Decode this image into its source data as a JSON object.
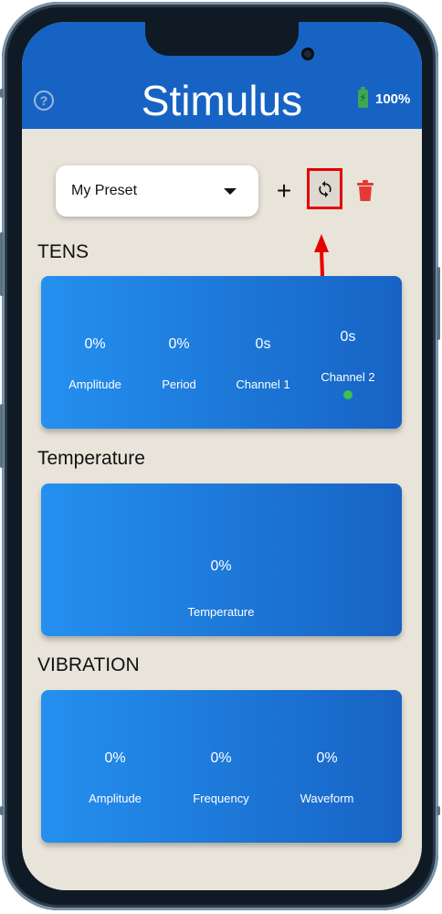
{
  "header": {
    "title": "Stimulus",
    "battery": "100%",
    "icons": {
      "help": "help-circle-icon",
      "battery": "battery-charging-icon"
    }
  },
  "toolbar": {
    "preset_selected": "My Preset",
    "add_label": "+",
    "icons": {
      "dropdown": "caret-down-icon",
      "refresh": "refresh-icon",
      "delete": "trash-icon"
    },
    "delete_color": "#e53935",
    "highlight_color": "#e60000"
  },
  "sections": {
    "tens": {
      "title": "TENS",
      "metrics": [
        {
          "value": "0%",
          "label": "Amplitude"
        },
        {
          "value": "0%",
          "label": "Period"
        },
        {
          "value": "0s",
          "label": "Channel 1"
        },
        {
          "value": "0s",
          "label": "Channel 2"
        }
      ],
      "channel2_status_color": "#3fbf4f"
    },
    "temperature": {
      "title": "Temperature",
      "metrics": [
        {
          "value": "0%",
          "label": "Temperature"
        }
      ]
    },
    "vibration": {
      "title": "VIBRATION",
      "metrics": [
        {
          "value": "0%",
          "label": "Amplitude"
        },
        {
          "value": "0%",
          "label": "Frequency"
        },
        {
          "value": "0%",
          "label": "Waveform"
        }
      ]
    }
  },
  "colors": {
    "header_bg": "#1763c4",
    "card_gradient_start": "#2490ef",
    "card_gradient_end": "#1763c4",
    "screen_bg": "#e8e4da"
  }
}
